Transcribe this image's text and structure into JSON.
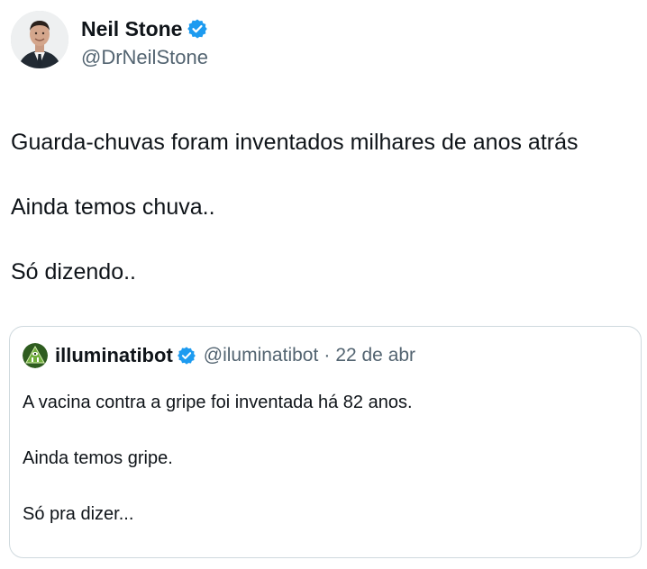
{
  "author": {
    "display_name": "Neil Stone",
    "handle": "@DrNeilStone",
    "verified": true,
    "avatar_icon": "profile-photo"
  },
  "tweet": {
    "lines": [
      "Guarda-chuvas foram inventados milhares de anos atrás",
      "Ainda temos chuva..",
      "Só dizendo.."
    ]
  },
  "quoted_tweet": {
    "display_name": "illuminatibot",
    "handle": "@iluminatibot",
    "separator": "·",
    "date": "22 de abr",
    "verified": true,
    "avatar_icon": "illuminati-eye-pyramid",
    "lines": [
      "A vacina contra a gripe foi inventada há 82 anos.",
      "Ainda temos gripe.",
      "Só pra dizer..."
    ]
  },
  "colors": {
    "text_primary": "#0f1419",
    "text_secondary": "#536471",
    "verified_blue": "#1d9bf0",
    "border": "#cfd9de",
    "illuminati_green": "#3f7d2a"
  }
}
